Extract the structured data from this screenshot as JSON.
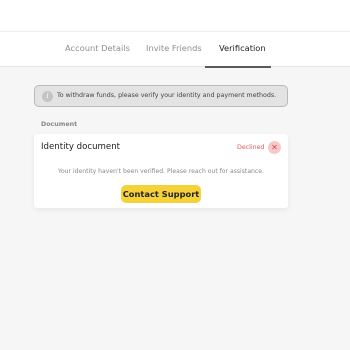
{
  "tabs": [
    {
      "label": "Account Details",
      "active": false
    },
    {
      "label": "Invite Friends",
      "active": false
    },
    {
      "label": "Verification",
      "active": true
    }
  ],
  "notice": {
    "icon": "info-icon",
    "text": "To withdraw funds, please verify your identity and payment methods."
  },
  "document_section": {
    "label": "Document",
    "item": {
      "title": "Identity document",
      "status": "Declined",
      "status_icon": "close-icon",
      "status_color": "#e0595a",
      "message": "Your identity haven't been verified. Please reach out for assistance.",
      "button_label": "Contact Support",
      "button_color": "#f6d23a"
    }
  }
}
